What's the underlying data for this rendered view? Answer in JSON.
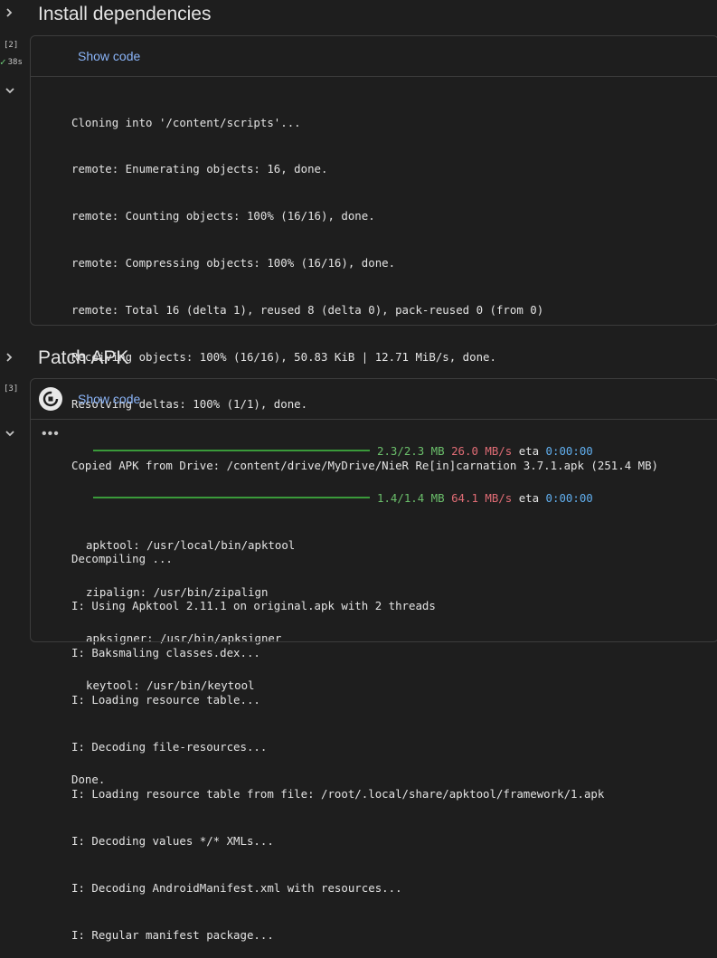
{
  "section1": {
    "heading": "Install dependencies",
    "exec_count": "[2]",
    "exec_time": "38s",
    "show_code": "Show code",
    "output": {
      "lines": [
        "Cloning into '/content/scripts'...",
        "remote: Enumerating objects: 16, done.",
        "remote: Counting objects: 100% (16/16), done.",
        "remote: Compressing objects: 100% (16/16), done.",
        "remote: Total 16 (delta 1), reused 8 (delta 0), pack-reused 0 (from 0)",
        "Receiving objects: 100% (16/16), 50.83 KiB | 12.71 MiB/s, done.",
        "Resolving deltas: 100% (1/1), done."
      ],
      "progress": [
        {
          "size": "2.3/2.3 MB",
          "speed": "26.0 MB/s",
          "eta_label": "eta",
          "eta": "0:00:00",
          "fraction": 1.0
        },
        {
          "size": "1.4/1.4 MB",
          "speed": "64.1 MB/s",
          "eta_label": "eta",
          "eta": "0:00:00",
          "fraction": 1.0
        }
      ],
      "tools": [
        "apktool: /usr/local/bin/apktool",
        "zipalign: /usr/bin/zipalign",
        "apksigner: /usr/bin/apksigner",
        "keytool: /usr/bin/keytool"
      ],
      "done": "Done."
    }
  },
  "section2": {
    "heading": "Patch APK",
    "exec_count": "[3]",
    "show_code": "Show code",
    "running_indicator": "•••",
    "output": {
      "lines": [
        "Copied APK from Drive: /content/drive/MyDrive/NieR Re[in]carnation 3.7.1.apk (251.4 MB)",
        "",
        "Decompiling ...",
        "I: Using Apktool 2.11.1 on original.apk with 2 threads",
        "I: Baksmaling classes.dex...",
        "I: Loading resource table...",
        "I: Decoding file-resources...",
        "I: Loading resource table from file: /root/.local/share/apktool/framework/1.apk",
        "I: Decoding values */* XMLs...",
        "I: Decoding AndroidManifest.xml with resources...",
        "I: Regular manifest package..."
      ]
    }
  }
}
